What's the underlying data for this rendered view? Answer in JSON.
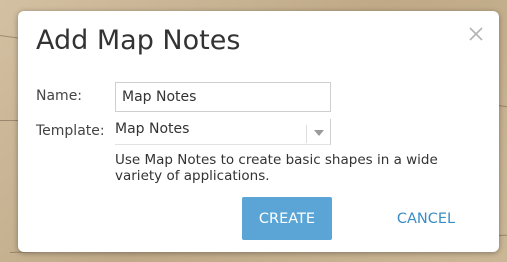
{
  "dialog": {
    "title": "Add Map Notes",
    "close_icon": "close-icon",
    "name_label": "Name:",
    "name_value": "Map Notes",
    "template_label": "Template:",
    "template_value": "Map Notes",
    "template_arrow_icon": "chevron-down-icon",
    "description": "Use Map Notes to create basic shapes in a wide variety of applications.",
    "create_label": "CREATE",
    "cancel_label": "CANCEL"
  },
  "colors": {
    "primary_button": "#5aa5d6",
    "link_button": "#3b8dc6",
    "title_text": "#333333",
    "backdrop": "#c9b597"
  }
}
